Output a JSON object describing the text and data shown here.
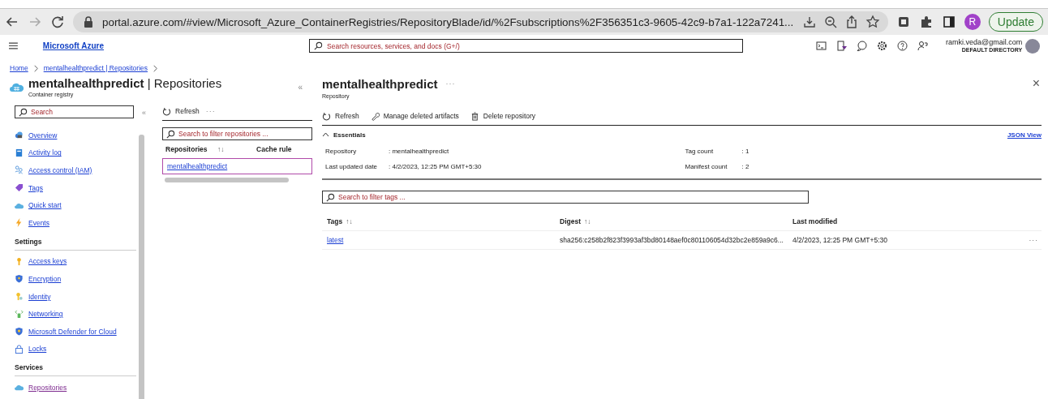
{
  "browser": {
    "url": "portal.azure.com/#view/Microsoft_Azure_ContainerRegistries/RepositoryBlade/id/%2Fsubscriptions%2F356351c3-9605-42c9-b7a1-122a7241...",
    "profile_initial": "R",
    "update_button": "Update"
  },
  "portal_header": {
    "brand": "Microsoft Azure",
    "search_placeholder": "Search resources, services, and docs (G+/)",
    "user_email": "ramki.veda@gmail.com",
    "directory": "DEFAULT DIRECTORY"
  },
  "breadcrumb": [
    "Home",
    "mentalhealthpredict | Repositories"
  ],
  "registry_blade": {
    "title": "**mentalhealthpredict** | Repositories",
    "subtitle": "Container registry",
    "collapse": "«",
    "search_placeholder": "Search",
    "sections": [
      {
        "items": [
          {
            "label": "Overview",
            "selected": false
          },
          {
            "label": "Activity log",
            "selected": false
          },
          {
            "label": "Access control (IAM)",
            "selected": false
          },
          {
            "label": "Tags",
            "selected": false
          },
          {
            "label": "Quick start",
            "selected": false
          },
          {
            "label": "Events",
            "selected": false
          }
        ]
      },
      {
        "heading": "Settings",
        "items": [
          {
            "label": "Access keys",
            "selected": false
          },
          {
            "label": "Encryption",
            "selected": false
          },
          {
            "label": "Identity",
            "selected": false
          },
          {
            "label": "Networking",
            "selected": false
          },
          {
            "label": "Microsoft Defender for Cloud",
            "selected": false
          },
          {
            "label": "Locks",
            "selected": false
          }
        ]
      },
      {
        "heading": "Services",
        "items": [
          {
            "label": "Repositories",
            "selected": true
          }
        ]
      }
    ]
  },
  "repository_list": {
    "toolbar": [
      "Refresh"
    ],
    "more": "···",
    "search_placeholder": "Search to filter repositories ...",
    "columns": [
      {
        "label": "Repositories",
        "sort": "↑↓"
      },
      {
        "label": "Cache rule"
      }
    ],
    "rows": [
      {
        "name": "mentalhealthpredict",
        "selected": true
      }
    ]
  },
  "repository_detail": {
    "title": "mentalhealthpredict",
    "more": "···",
    "subtitle": "Repository",
    "close": "×",
    "toolbar": [
      "Refresh",
      "Manage deleted artifacts",
      "Delete repository"
    ],
    "essentials": {
      "label": "Essentials",
      "expanded": true,
      "json_view": "JSON View",
      "left": [
        {
          "label": "Repository",
          "value": ": mentalhealthpredict"
        },
        {
          "label": "Last updated date",
          "value": ": 4/2/2023, 12:25 PM GMT+5:30"
        }
      ],
      "right": [
        {
          "label": "Tag count",
          "value": ": 1"
        },
        {
          "label": "Manifest count",
          "value": ": 2"
        }
      ]
    },
    "tags_search_placeholder": "Search to filter tags ...",
    "columns": [
      {
        "label": "Tags",
        "sort": "↑↓"
      },
      {
        "label": "Digest",
        "sort": "↑↓"
      },
      {
        "label": "Last modified"
      }
    ],
    "rows": [
      {
        "tag": "latest",
        "digest": "sha256:c258b2f823f3993af3bd80148aef0c801106054d32bc2e859a9c6...",
        "last_modified": "4/2/2023, 12:25 PM GMT+5:30",
        "more": "···"
      }
    ]
  }
}
